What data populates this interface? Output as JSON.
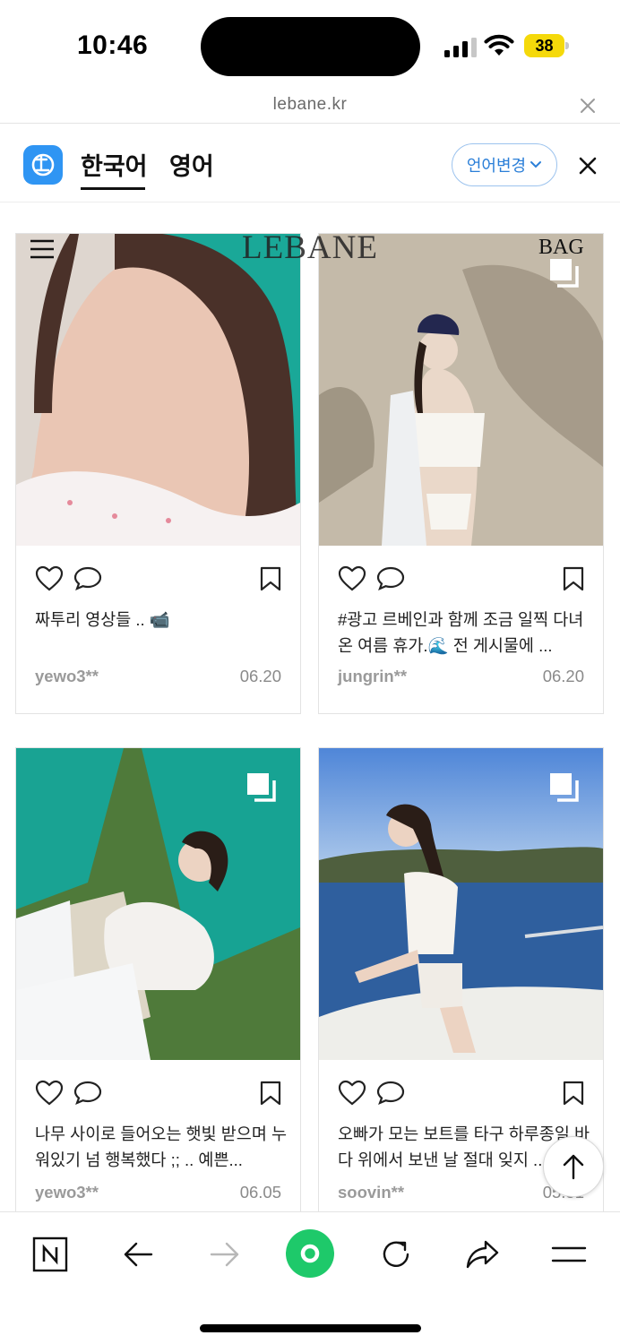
{
  "status_bar": {
    "time": "10:46",
    "battery": "38"
  },
  "url_bar": {
    "url": "lebane.kr"
  },
  "translate_bar": {
    "lang_korean": "한국어",
    "lang_english": "영어",
    "change_language": "언어변경"
  },
  "site_header": {
    "logo": "LEBANE",
    "bag": "BAG"
  },
  "posts": [
    {
      "caption": "짜투리 영상들 .. 📹",
      "user": "yewo3**",
      "date": "06.20"
    },
    {
      "caption": "#광고 르베인과 함께 조금 일찍 다녀온 여름 휴가.🌊 전 게시물에 ...",
      "user": "jungrin**",
      "date": "06.20"
    },
    {
      "caption": "나무 사이로 들어오는 햇빛 받으며 누워있기 넘 행복했다 ;; .. 예쁜...",
      "user": "yewo3**",
      "date": "06.05"
    },
    {
      "caption": "오빠가 모는 보트를 타구 하루종일 바다 위에서 보낸 날 절대 잊지 ...",
      "user": "soovin**",
      "date": "05.31"
    }
  ],
  "colors": {
    "accent_blue": "#2f95f3",
    "toolbar_green": "#1ec96a"
  },
  "icons": [
    "heart-icon",
    "comment-icon",
    "bookmark-icon",
    "multi-image-icon",
    "arrow-up-icon",
    "back-arrow-icon",
    "forward-arrow-icon",
    "reload-icon",
    "share-icon",
    "menu-icon"
  ]
}
